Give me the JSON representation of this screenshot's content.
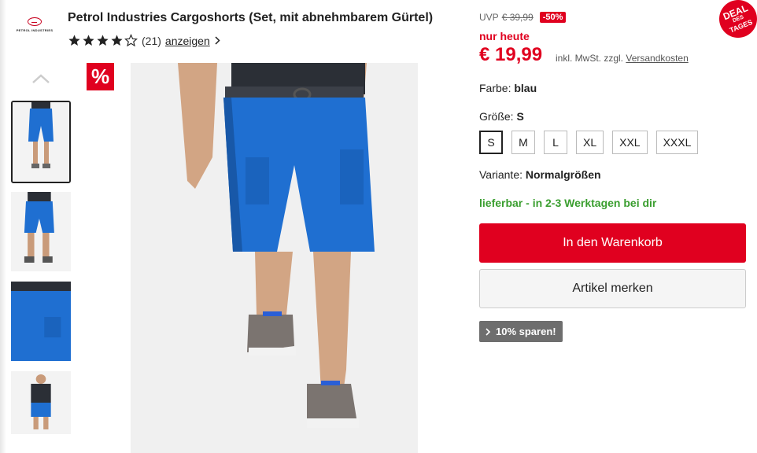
{
  "brand": {
    "logo_text": "PETROL INDUSTRIES",
    "icon": "petrol-logo-icon"
  },
  "product": {
    "title": "Petrol Industries Cargoshorts (Set, mit abnehmbarem Gürtel)",
    "rating_value": 4,
    "rating_max": 5,
    "rating_count": "(21)",
    "rating_link": "anzeigen"
  },
  "badges": {
    "sale_symbol": "%",
    "deal_line1": "DEAL",
    "deal_line2": "DES",
    "deal_line3": "TAGES"
  },
  "pricing": {
    "uvp_label": "UVP",
    "uvp_old": "€ 39,99",
    "discount": "-50%",
    "nur_heute": "nur heute",
    "price": "€ 19,99",
    "vat_text": "inkl. MwSt. zzgl.",
    "shipping_link": "Versandkosten"
  },
  "color": {
    "label": "Farbe:",
    "value": "blau"
  },
  "size": {
    "label": "Größe:",
    "selected": "S",
    "options": [
      "S",
      "M",
      "L",
      "XL",
      "XXL",
      "XXXL"
    ]
  },
  "variant": {
    "label": "Variante:",
    "value": "Normalgrößen"
  },
  "availability": "lieferbar - in 2-3 Werktagen bei dir",
  "actions": {
    "add_to_cart": "In den Warenkorb",
    "wishlist": "Artikel merken",
    "save": "10% sparen!"
  },
  "colors": {
    "accent": "#e0001f",
    "product_blue": "#1f6fd1",
    "available_green": "#3a9e2f"
  }
}
